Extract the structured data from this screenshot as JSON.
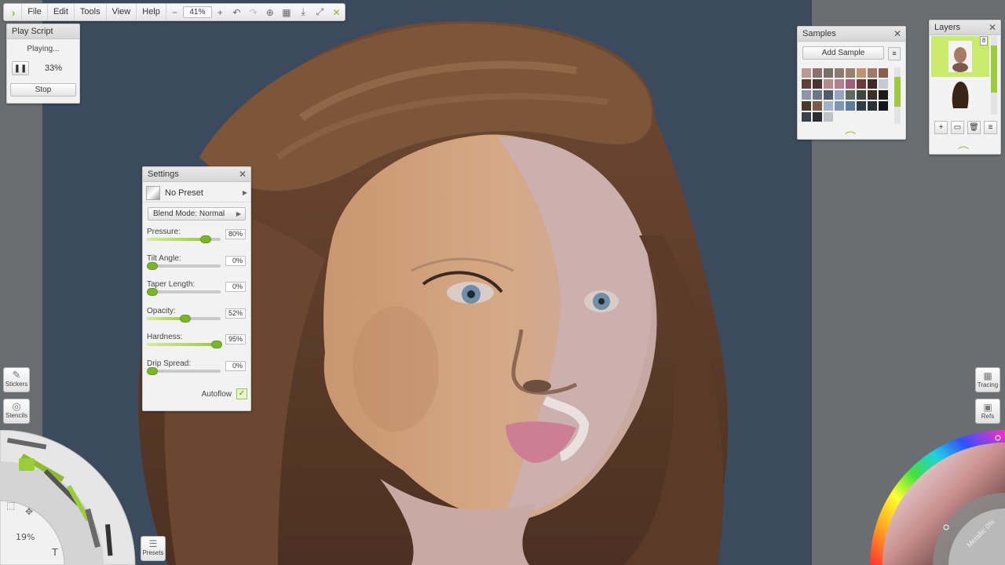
{
  "menu": {
    "items": [
      "File",
      "Edit",
      "Tools",
      "View",
      "Help"
    ],
    "zoom_minus": "−",
    "zoom_value": "41%",
    "zoom_plus": "+"
  },
  "play_script": {
    "title": "Play Script",
    "status": "Playing...",
    "progress": "33%",
    "stop_label": "Stop"
  },
  "settings": {
    "title": "Settings",
    "preset": "No Preset",
    "blend_mode": "Blend Mode: Normal",
    "sliders": [
      {
        "label": "Pressure:",
        "value": "80%",
        "level": 80
      },
      {
        "label": "Tilt Angle:",
        "value": "0%",
        "level": 0
      },
      {
        "label": "Taper Length:",
        "value": "0%",
        "level": 0
      },
      {
        "label": "Opacity:",
        "value": "52%",
        "level": 52
      },
      {
        "label": "Hardness:",
        "value": "95%",
        "level": 95
      },
      {
        "label": "Drip Spread:",
        "value": "0%",
        "level": 0
      }
    ],
    "autoflow_label": "Autoflow",
    "autoflow_checked": true
  },
  "samples": {
    "title": "Samples",
    "add_label": "Add Sample",
    "swatches": [
      "#b99a93",
      "#8d6f6b",
      "#7a7067",
      "#8e7a6c",
      "#9a7f6a",
      "#c0936c",
      "#a3766b",
      "#8b5c4c",
      "#5e4038",
      "#4a3431",
      "#b58a8e",
      "#b27f8d",
      "#a05d7c",
      "#6b3b3b",
      "#3f2a25",
      "#c3cbd6",
      "#8a97a8",
      "#6a7786",
      "#4f5b67",
      "#94a6bf",
      "#5d6b5f",
      "#3f463e",
      "#3b3027",
      "#1e1b19",
      "#4b3525",
      "#7a5a45",
      "#a2b3c8",
      "#7e97b5",
      "#5b7c9b",
      "#2d3c48",
      "#283038",
      "#141618",
      "#3a3f49",
      "#2a2d33",
      "#bfc3c8"
    ]
  },
  "layers": {
    "title": "Layers"
  },
  "left_tools": {
    "stickers": "Stickers",
    "stencils": "Stencils",
    "tool_size": "19%",
    "presets": "Presets"
  },
  "right_tools": {
    "tracing": "Tracing",
    "refs": "Refs",
    "metallic": "Metallic 0%"
  },
  "colors": {
    "accent": "#8cc63f",
    "canvas_bg": "#3b4a5c"
  }
}
